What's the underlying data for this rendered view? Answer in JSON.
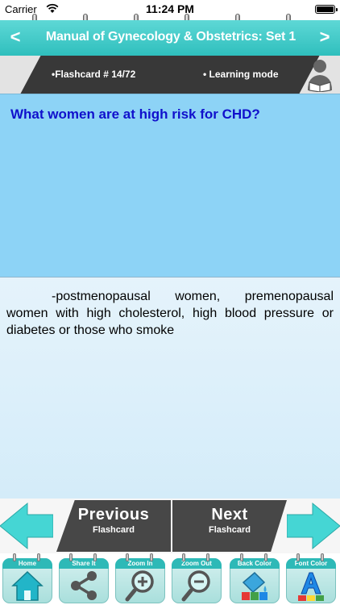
{
  "status_bar": {
    "carrier": "Carrier",
    "time": "11:24 PM"
  },
  "header": {
    "title": "Manual of Gynecology & Obstetrics: Set 1",
    "back_icon": "<",
    "forward_icon": ">"
  },
  "mode_strip": {
    "counter": "•Flashcard #  14/72",
    "mode": "• Learning mode",
    "icon": "reader-icon"
  },
  "card": {
    "question": "What women are at high risk for CHD?",
    "answer": "-postmenopausal women, premenopausal women with high cholesterol, high blood pressure or diabetes or those who smoke"
  },
  "navigation": {
    "previous": {
      "title": "Previous",
      "subtitle": "Flashcard"
    },
    "next": {
      "title": "Next",
      "subtitle": "Flashcard"
    }
  },
  "toolbar": {
    "items": [
      {
        "label": "Home",
        "icon": "home-icon"
      },
      {
        "label": "Share It",
        "icon": "share-icon"
      },
      {
        "label": "Zoom In",
        "icon": "zoom-in-icon"
      },
      {
        "label": "Zoom Out",
        "icon": "zoom-out-icon"
      },
      {
        "label": "Back Color",
        "icon": "back-color-icon"
      },
      {
        "label": "Font Color",
        "icon": "font-color-icon"
      }
    ]
  },
  "colors": {
    "title_bar": "#2fbfbd",
    "question_bg": "#8dd3f6",
    "question_text": "#1010cc",
    "answer_bg": "#e5f3fb",
    "nav_button": "#474747"
  }
}
